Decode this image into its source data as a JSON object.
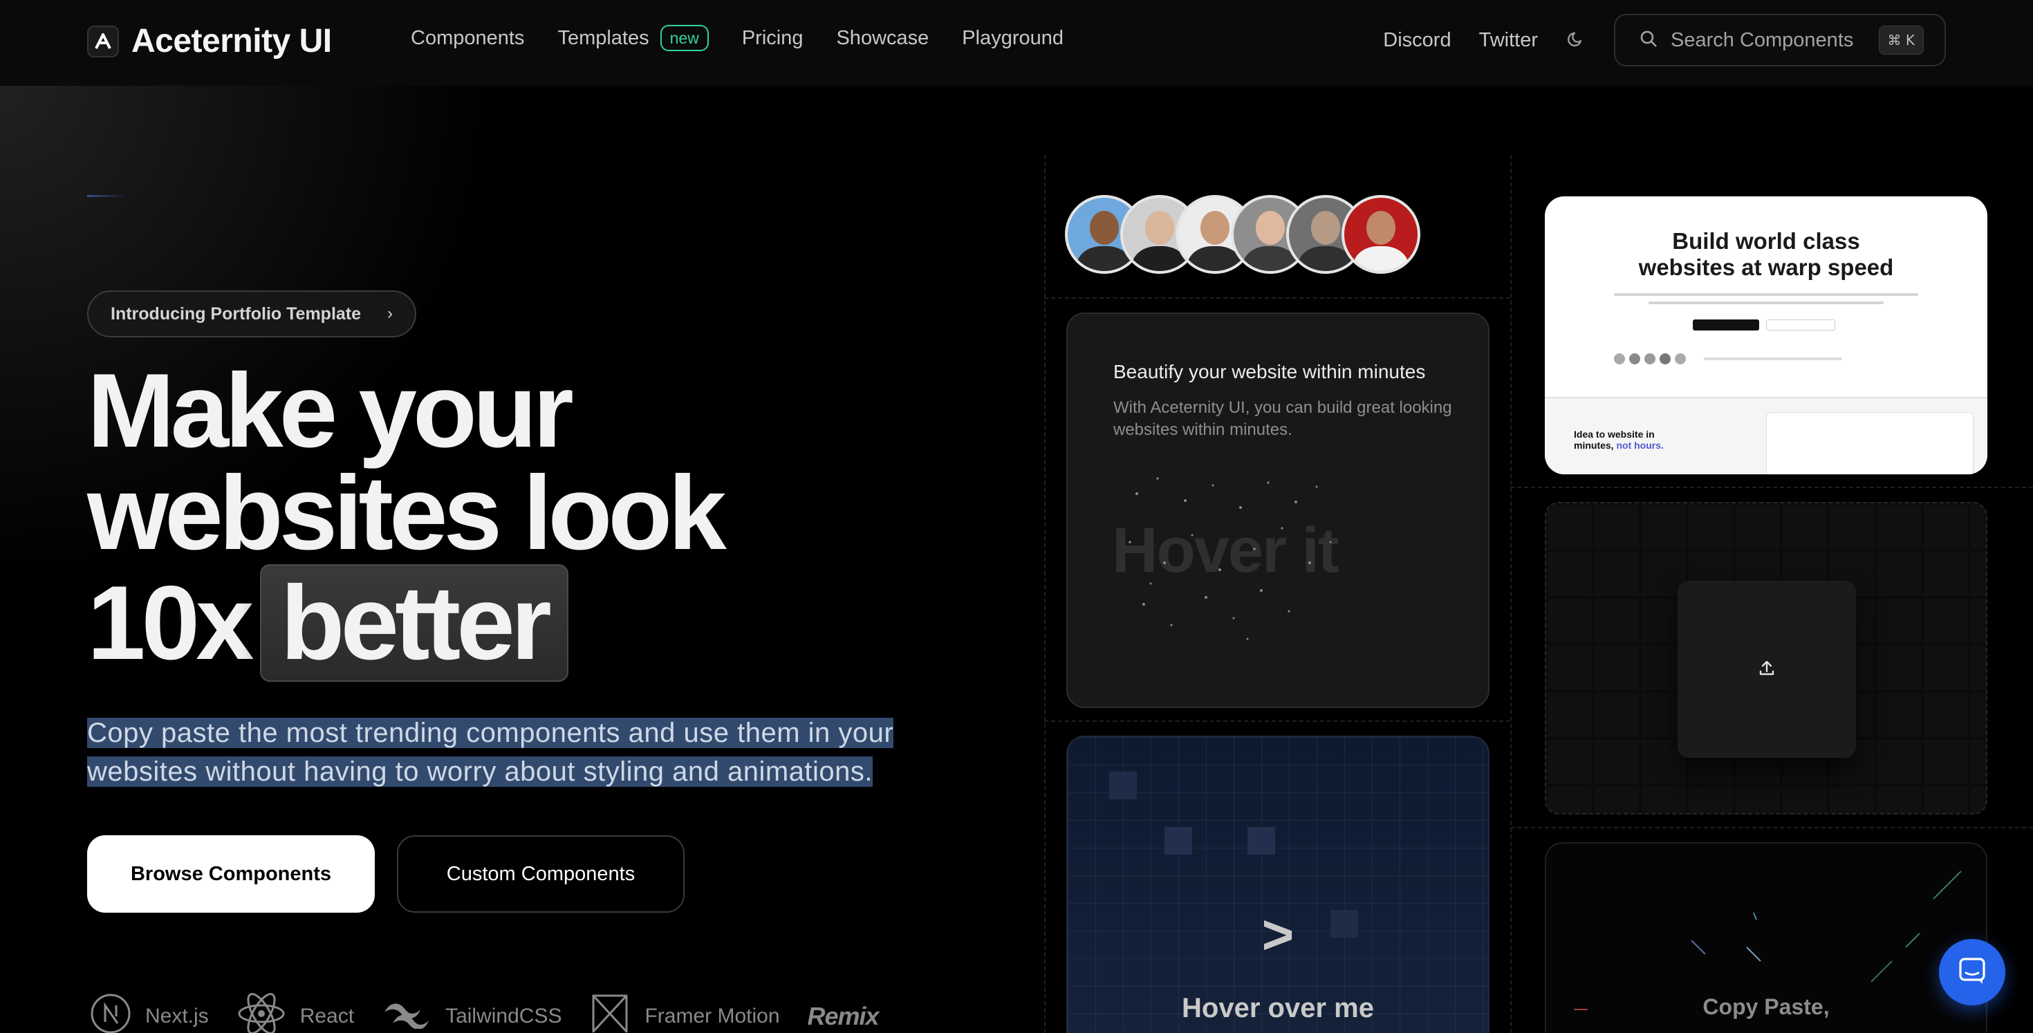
{
  "brand": {
    "name": "Aceternity UI"
  },
  "nav": {
    "links": [
      {
        "label": "Components"
      },
      {
        "label": "Templates",
        "badge": "new"
      },
      {
        "label": "Pricing"
      },
      {
        "label": "Showcase"
      },
      {
        "label": "Playground"
      }
    ],
    "right_links": [
      {
        "label": "Discord"
      },
      {
        "label": "Twitter"
      }
    ],
    "theme_icon": "moon-icon",
    "search": {
      "placeholder": "Search Components",
      "shortcut": "⌘ K"
    }
  },
  "hero": {
    "intro_pill": "Introducing Portfolio Template",
    "headline_line1": "Make your",
    "headline_line2": "websites look",
    "headline_line3_prefix": "10x",
    "headline_highlight": "better",
    "subtext": "Copy paste the most trending components and use them in your websites without having to worry about styling and animations.",
    "primary_button": "Browse Components",
    "secondary_button": "Custom Components",
    "techs": [
      {
        "name": "Next.js",
        "icon": "nextjs-icon"
      },
      {
        "name": "React",
        "icon": "react-icon"
      },
      {
        "name": "TailwindCSS",
        "icon": "tailwind-icon"
      },
      {
        "name": "Framer Motion",
        "icon": "framer-motion-icon"
      },
      {
        "name": "Remix",
        "icon": "remix-logo"
      }
    ]
  },
  "cards": {
    "beautify": {
      "title": "Beautify your website within minutes",
      "description": "With Aceternity UI, you can build great looking websites within minutes.",
      "hover_text": "Hover it"
    },
    "hover_grid": {
      "chevron": ">",
      "label": "Hover over me"
    },
    "warp": {
      "title_line1": "Build world class",
      "title_line2_prefix": "websites at",
      "title_highlight": "warp speed",
      "bottom_line1": "Idea to website in",
      "bottom_line2_prefix": "minutes,",
      "bottom_highlight": "not hours."
    },
    "upload": {
      "icon": "upload-icon"
    },
    "copy": {
      "label": "Copy Paste,"
    }
  },
  "colors": {
    "accent_green": "#34d399",
    "highlight_bg": "#324a6e",
    "chat_blue": "#2563eb"
  }
}
